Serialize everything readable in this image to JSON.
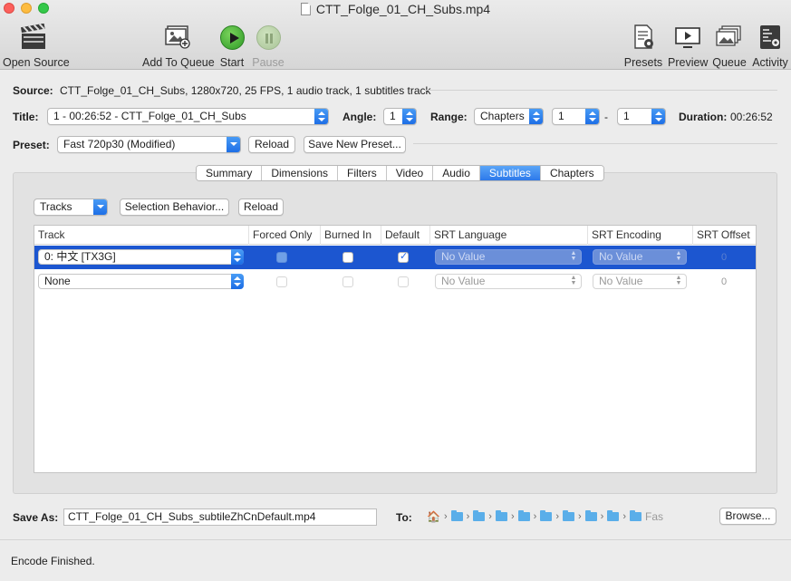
{
  "window": {
    "title": "CTT_Folge_01_CH_Subs.mp4"
  },
  "toolbar": {
    "open_source": "Open Source",
    "add_to_queue": "Add To Queue",
    "start": "Start",
    "pause": "Pause",
    "presets": "Presets",
    "preview": "Preview",
    "queue": "Queue",
    "activity": "Activity"
  },
  "source": {
    "label": "Source:",
    "value": "CTT_Folge_01_CH_Subs, 1280x720, 25 FPS, 1 audio track, 1 subtitles track"
  },
  "title_row": {
    "title_label": "Title:",
    "title_value": "1 - 00:26:52 - CTT_Folge_01_CH_Subs",
    "angle_label": "Angle:",
    "angle_value": "1",
    "range_label": "Range:",
    "range_value": "Chapters",
    "range_start": "1",
    "range_dash": "-",
    "range_end": "1",
    "duration_label": "Duration:",
    "duration_value": "00:26:52"
  },
  "preset_row": {
    "label": "Preset:",
    "value": "Fast 720p30 (Modified)",
    "reload": "Reload",
    "save_new": "Save New Preset..."
  },
  "tabs": [
    "Summary",
    "Dimensions",
    "Filters",
    "Video",
    "Audio",
    "Subtitles",
    "Chapters"
  ],
  "active_tab": "Subtitles",
  "subtitles": {
    "tracks_menu": "Tracks",
    "selection_behavior": "Selection Behavior...",
    "reload": "Reload",
    "columns": [
      "Track",
      "Forced Only",
      "Burned In",
      "Default",
      "SRT Language",
      "SRT Encoding",
      "SRT Offset"
    ],
    "rows": [
      {
        "track": "0: 中文 [TX3G]",
        "forced_only": false,
        "burned_in": false,
        "default": true,
        "srt_language": "No Value",
        "srt_encoding": "No Value",
        "srt_offset": "0",
        "selected": true
      },
      {
        "track": "None",
        "forced_only": false,
        "burned_in": false,
        "default": false,
        "srt_language": "No Value",
        "srt_encoding": "No Value",
        "srt_offset": "0",
        "selected": false
      }
    ]
  },
  "save": {
    "label": "Save As:",
    "filename": "CTT_Folge_01_CH_Subs_subtileZhCnDefault.mp4",
    "to_label": "To:",
    "path_tail": "Fas",
    "browse": "Browse..."
  },
  "status": {
    "text": "Encode Finished."
  },
  "colors": {
    "accent": "#1c56d0",
    "tab_active": "#2d79ea",
    "play": "#2e9a26"
  }
}
